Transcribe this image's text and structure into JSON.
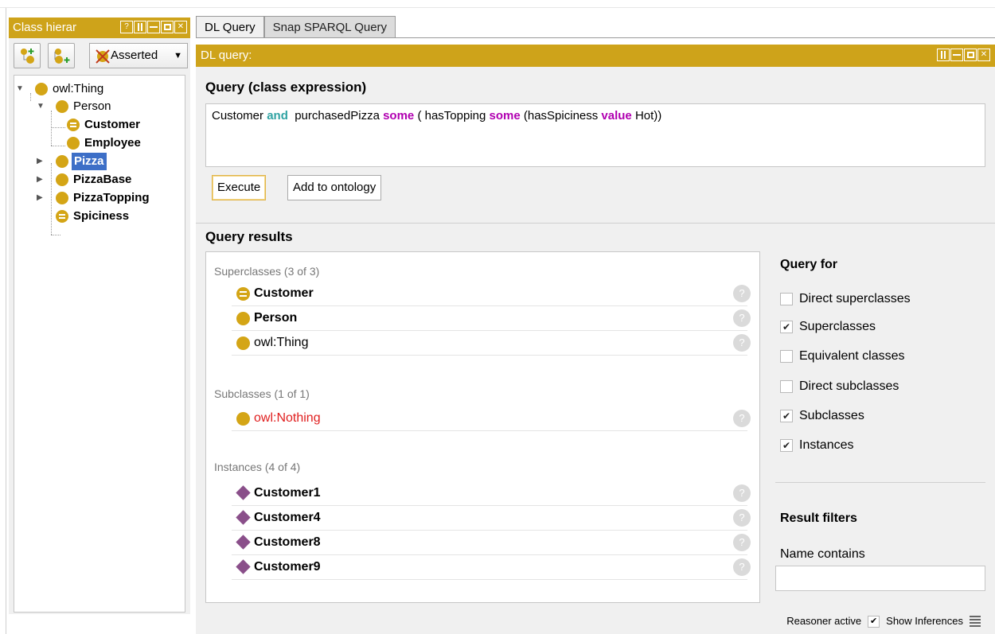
{
  "left_panel": {
    "title": "Class hierar",
    "window_buttons": [
      "?",
      "pin",
      "min",
      "max",
      "close"
    ],
    "toolbar": {
      "add_subclass_icon": "add-subclass-icon",
      "add_sibling_icon": "add-sibling-icon",
      "delete_icon": "delete-class-icon",
      "view_selector": "Asserted"
    },
    "tree": [
      {
        "label": "owl:Thing",
        "depth": 0,
        "expanded": true,
        "bold": false,
        "icon": "class-icon"
      },
      {
        "label": "Person",
        "depth": 1,
        "expanded": true,
        "bold": false,
        "icon": "class-icon"
      },
      {
        "label": "Customer",
        "depth": 2,
        "bold": true,
        "icon": "defined-class-icon"
      },
      {
        "label": "Employee",
        "depth": 2,
        "bold": true,
        "icon": "class-icon"
      },
      {
        "label": "Pizza",
        "depth": 1,
        "expanded": false,
        "bold": true,
        "selected": true,
        "icon": "class-icon"
      },
      {
        "label": "PizzaBase",
        "depth": 1,
        "expanded": false,
        "bold": true,
        "icon": "class-icon"
      },
      {
        "label": "PizzaTopping",
        "depth": 1,
        "expanded": false,
        "bold": true,
        "icon": "class-icon"
      },
      {
        "label": "Spiciness",
        "depth": 1,
        "bold": true,
        "icon": "defined-class-icon"
      }
    ]
  },
  "tabs": [
    {
      "label": "DL Query",
      "active": true
    },
    {
      "label": "Snap SPARQL Query",
      "active": false
    }
  ],
  "dl_query": {
    "panel_title": "DL query:",
    "query_section_title": "Query (class expression)",
    "query": {
      "t1": "Customer ",
      "and": "and",
      "t2": "  purchasedPizza ",
      "some1": "some",
      "t3": " ( hasTopping ",
      "some2": "some",
      "t4": " (hasSpiciness ",
      "value": "value",
      "t5": " Hot))"
    },
    "execute_label": "Execute",
    "add_label": "Add to ontology",
    "results_title": "Query results",
    "superclasses": {
      "label": "Superclasses (3 of 3)",
      "items": [
        {
          "name": "Customer",
          "icon": "defined-class-icon"
        },
        {
          "name": "Person",
          "icon": "class-icon"
        },
        {
          "name": "owl:Thing",
          "icon": "class-icon"
        }
      ]
    },
    "subclasses": {
      "label": "Subclasses (1 of 1)",
      "items": [
        {
          "name": "owl:Nothing",
          "icon": "class-icon"
        }
      ]
    },
    "instances": {
      "label": "Instances (4 of 4)",
      "items": [
        {
          "name": "Customer1",
          "icon": "individual-icon"
        },
        {
          "name": "Customer4",
          "icon": "individual-icon"
        },
        {
          "name": "Customer8",
          "icon": "individual-icon"
        },
        {
          "name": "Customer9",
          "icon": "individual-icon"
        }
      ]
    },
    "help_glyph": "?",
    "query_for": {
      "title": "Query for",
      "options": [
        {
          "label": "Direct superclasses",
          "checked": false
        },
        {
          "label": "Superclasses",
          "checked": true
        },
        {
          "label": "Equivalent classes",
          "checked": false
        },
        {
          "label": "Direct subclasses",
          "checked": false
        },
        {
          "label": "Subclasses",
          "checked": true
        },
        {
          "label": "Instances",
          "checked": true
        }
      ]
    },
    "result_filters": {
      "title": "Result filters",
      "name_contains_label": "Name contains",
      "name_contains_value": ""
    }
  },
  "status_bar": {
    "reasoner": "Reasoner active",
    "show_inferences": "Show Inferences",
    "show_inferences_checked": true
  },
  "colors": {
    "title_bar": "#cea31a",
    "class_icon": "#d4a516",
    "individual_icon": "#8a4f8a",
    "selection": "#3d6fc7",
    "keyword": "#b100b1",
    "and_keyword": "#2fa3a3",
    "nothing": "#e01e1e"
  }
}
